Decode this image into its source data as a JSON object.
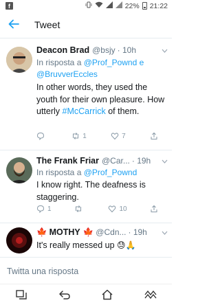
{
  "status": {
    "battery": "22%",
    "time": "21:22",
    "app_icon": "f"
  },
  "header": {
    "title": "Tweet"
  },
  "tweets": [
    {
      "name": "Deacon Brad",
      "handle": "@bsjy",
      "time": "· 10h",
      "reply_prefix": "In risposta a",
      "reply_mentions": "@Prof_Pownd e @BruvverEccles",
      "text_before": "In other words, they used the youth for their own pleasure. How utterly",
      "hashtag": "#McCarrick",
      "text_after": "of them.",
      "reply_count": "",
      "retweet_count": "1",
      "like_count": "7"
    },
    {
      "name": "The Frank Friar",
      "handle": "@Car...",
      "time": "· 19h",
      "reply_prefix": "In risposta a",
      "reply_mentions": "@Prof_Pownd",
      "text": "I know right.  The deafness is staggering.",
      "reply_count": "1",
      "retweet_count": "",
      "like_count": "10"
    },
    {
      "flag_left": "🍁",
      "name": "MOTHY",
      "flag_right": "🍁",
      "handle": "@Cdn...",
      "time": "· 19h",
      "text": "It's really messed up",
      "emoji": "😓🙏"
    }
  ],
  "reply_bar": {
    "placeholder": "Twitta una risposta"
  },
  "colors": {
    "accent": "#1da1f2",
    "muted": "#657786",
    "border": "#e6ecf0"
  }
}
